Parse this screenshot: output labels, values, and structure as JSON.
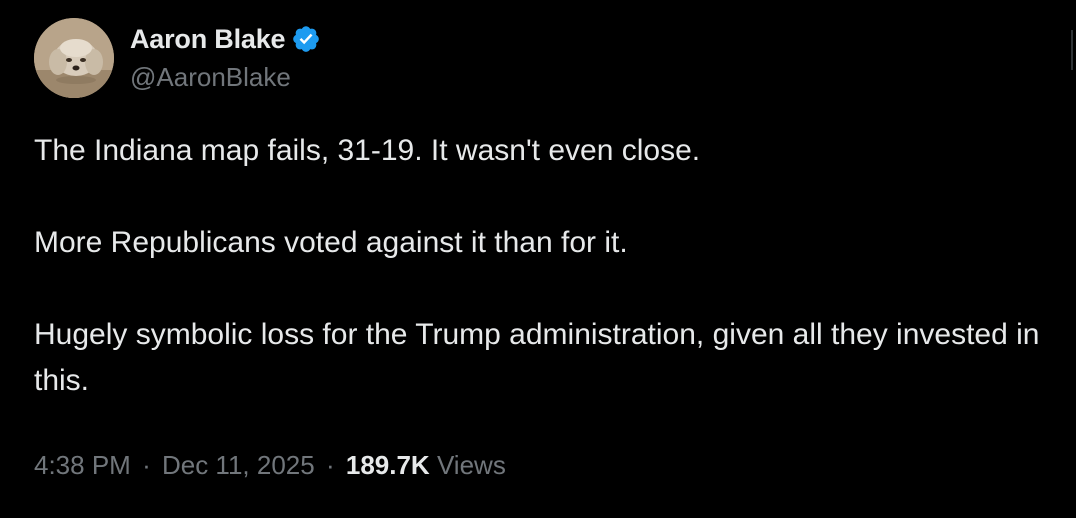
{
  "author": {
    "display_name": "Aaron Blake",
    "handle": "@AaronBlake",
    "verified": true,
    "verified_color": "#1d9bf0",
    "avatar_icon": "dog-avatar-icon"
  },
  "tweet": {
    "paragraphs": [
      "The Indiana map fails, 31-19. It wasn't even close.",
      "More Republicans voted against it than for it.",
      "Hugely symbolic loss for the Trump administration, given all they invested in this."
    ]
  },
  "meta": {
    "time": "4:38 PM",
    "separator": "·",
    "date": "Dec 11, 2025",
    "views_count": "189.7K",
    "views_label": "Views"
  },
  "colors": {
    "background": "#000000",
    "primary_text": "#e7e9ea",
    "secondary_text": "#71767b",
    "accent": "#1d9bf0"
  }
}
